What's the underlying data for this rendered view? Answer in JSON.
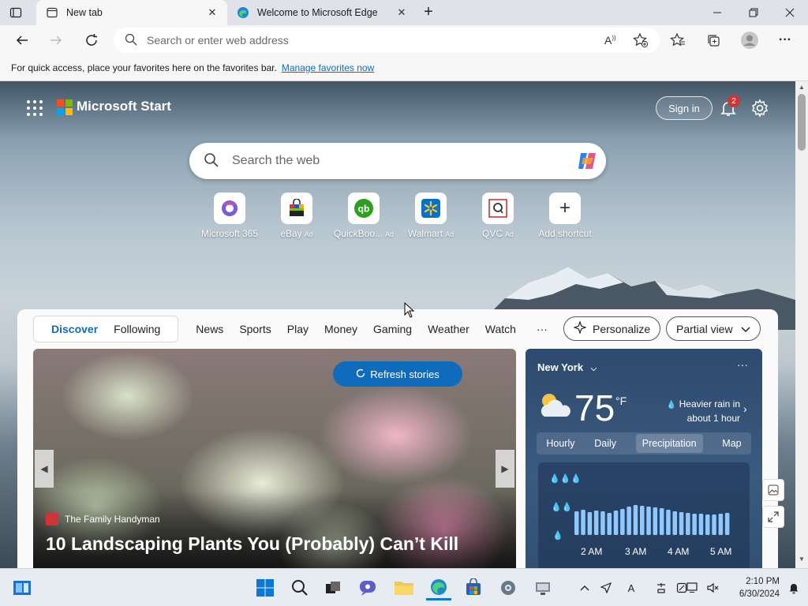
{
  "tabs": [
    {
      "title": "New tab"
    },
    {
      "title": "Welcome to Microsoft Edge"
    }
  ],
  "toolbar": {
    "address_placeholder": "Search or enter web address"
  },
  "favbar": {
    "message": "For quick access, place your favorites here on the favorites bar.",
    "link": "Manage favorites now"
  },
  "header": {
    "brand": "Microsoft Start",
    "signin": "Sign in",
    "notification_count": "2"
  },
  "search": {
    "placeholder": "Search the web"
  },
  "shortcuts": [
    {
      "label": "Microsoft 365",
      "ad": ""
    },
    {
      "label": "eBay",
      "ad": "Ad"
    },
    {
      "label": "QuickBoo...",
      "ad": "Ad"
    },
    {
      "label": "Walmart",
      "ad": "Ad"
    },
    {
      "label": "QVC",
      "ad": "Ad"
    },
    {
      "label": "Add shortcut",
      "ad": ""
    }
  ],
  "feed": {
    "primary_tabs": [
      "Discover",
      "Following"
    ],
    "nav": [
      "News",
      "Sports",
      "Play",
      "Money",
      "Gaming",
      "Weather",
      "Watch"
    ],
    "more": "···",
    "personalize": "Personalize",
    "view": "Partial view"
  },
  "hero": {
    "refresh": "Refresh stories",
    "source": "The Family Handyman",
    "title": "10 Landscaping Plants You (Probably) Can’t Kill"
  },
  "weather": {
    "city": "New York",
    "temp": "75",
    "unit": "°F",
    "note": "Heavier rain in about 1 hour",
    "tabs": [
      "Hourly",
      "Daily",
      "Precipitation",
      "Map"
    ],
    "x_labels": [
      "2 AM",
      "3 AM",
      "4 AM",
      "5 AM"
    ]
  },
  "clock": {
    "time": "2:10 PM",
    "date": "6/30/2024"
  },
  "colors": {
    "accent": "#0f6cbd",
    "badge": "#d13438"
  }
}
